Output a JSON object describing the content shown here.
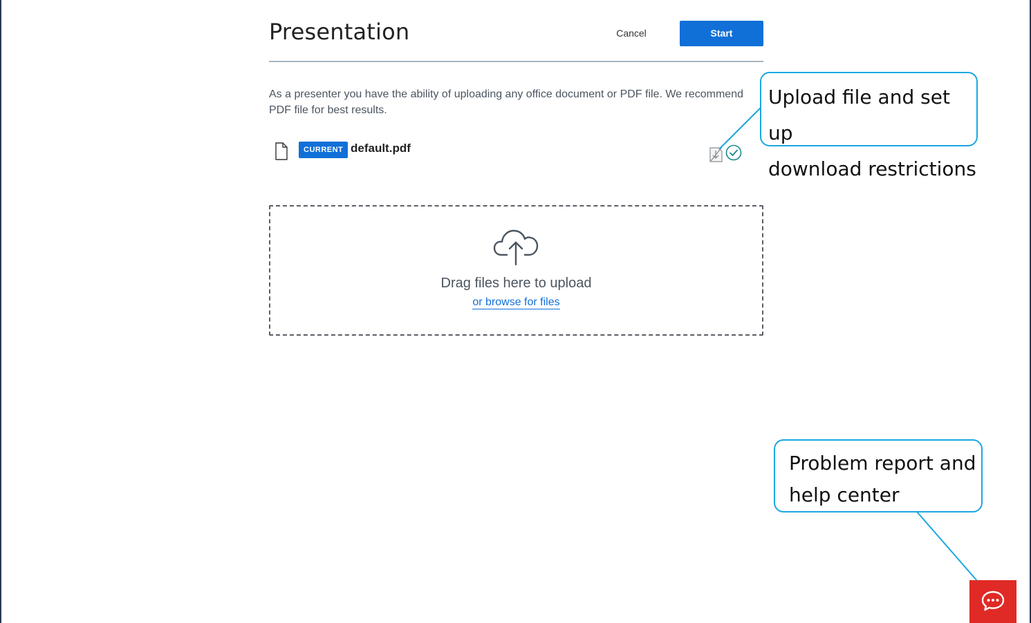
{
  "modal": {
    "title": "Presentation",
    "cancel_label": "Cancel",
    "start_label": "Start",
    "description": "As a presenter you have the ability of uploading any office document or PDF file. We recommend PDF file for best results."
  },
  "file": {
    "badge": "CURRENT",
    "name": "default.pdf",
    "icons": [
      "file-icon",
      "download-toggle-icon",
      "check-circle-icon"
    ]
  },
  "dropzone": {
    "icon": "cloud-upload-icon",
    "drag_text": "Drag files here to upload",
    "browse_text": "or browse for files"
  },
  "callouts": {
    "upload": {
      "line1": "Upload file and set up",
      "line2": "download restrictions"
    },
    "help": {
      "line1": "Problem report and",
      "line2": "help center"
    }
  },
  "help_button": {
    "icon": "chat-icon"
  },
  "colors": {
    "primary": "#1070d8",
    "callout_border": "#1aa7e0",
    "help_button": "#e02a25",
    "check": "#1a8a8a"
  }
}
